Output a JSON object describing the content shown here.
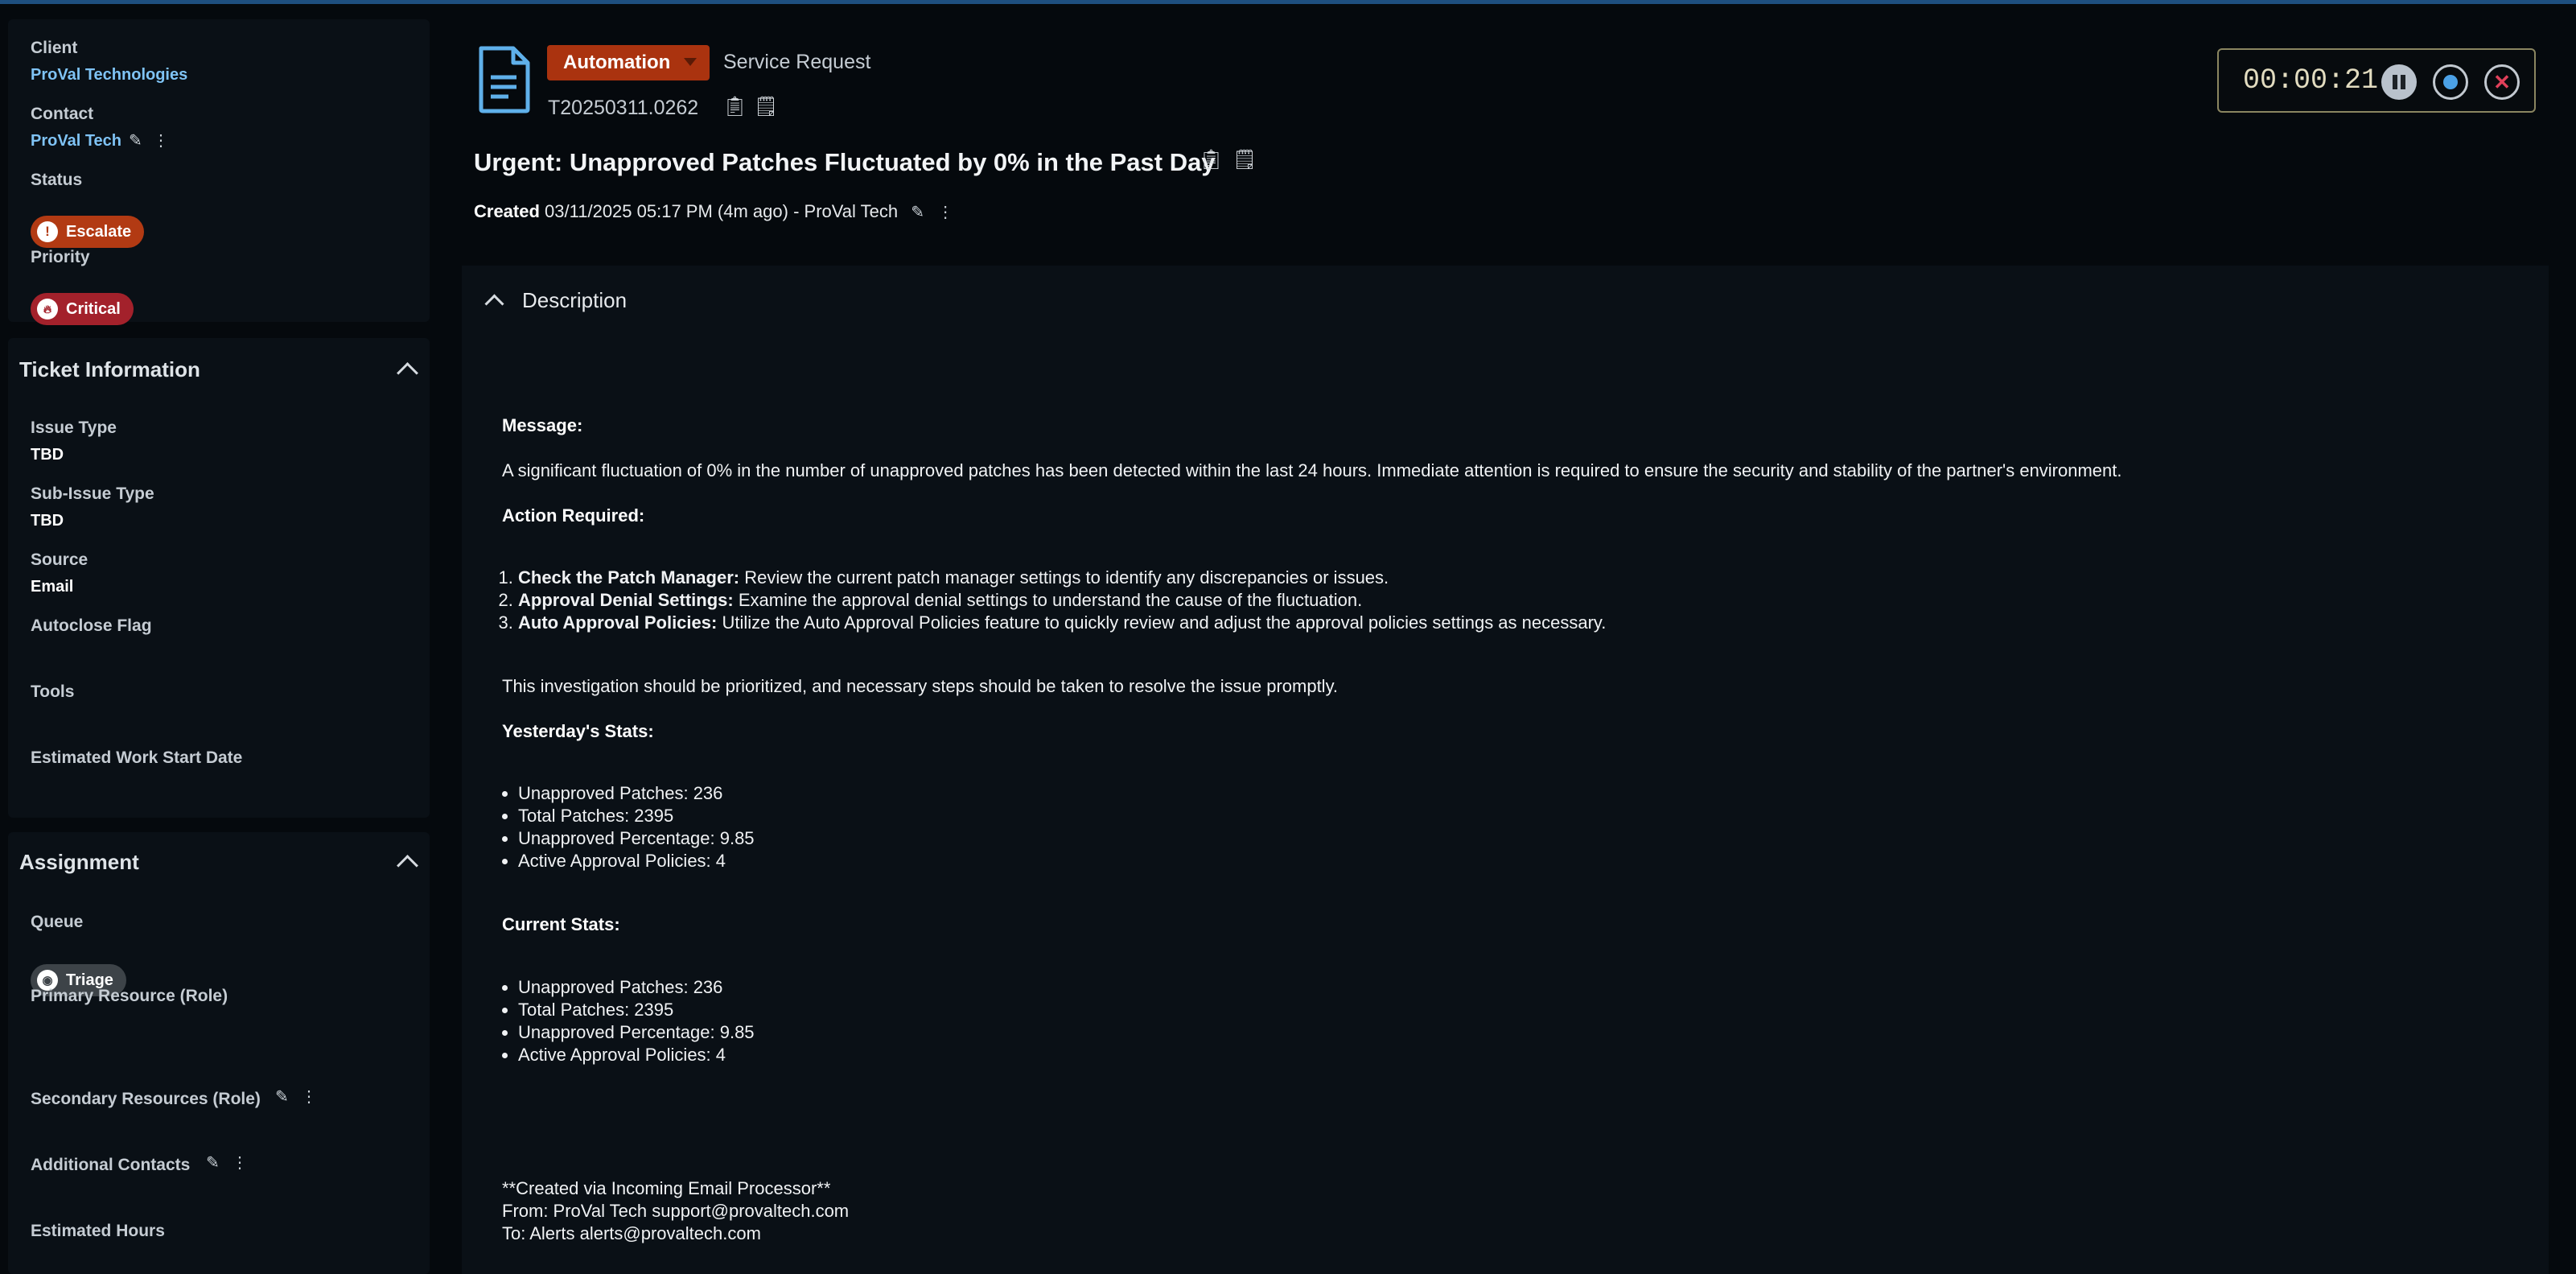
{
  "left": {
    "client_label": "Client",
    "client_value": "ProVal Technologies",
    "contact_label": "Contact",
    "contact_value": "ProVal Tech",
    "status_label": "Status",
    "status_value": "Escalate",
    "priority_label": "Priority",
    "priority_value": "Critical",
    "ticket_info": {
      "title": "Ticket Information",
      "issue_type_label": "Issue Type",
      "issue_type_value": "TBD",
      "sub_issue_label": "Sub-Issue Type",
      "sub_issue_value": "TBD",
      "source_label": "Source",
      "source_value": "Email",
      "autoclose_label": "Autoclose Flag",
      "tools_label": "Tools",
      "est_start_label": "Estimated Work Start Date"
    },
    "assignment": {
      "title": "Assignment",
      "queue_label": "Queue",
      "queue_value": "Triage",
      "primary_label": "Primary Resource (Role)",
      "secondary_label": "Secondary Resources (Role)",
      "additional_label": "Additional Contacts",
      "est_hours_label": "Estimated Hours"
    }
  },
  "header": {
    "type_button": "Automation",
    "service_request": "Service Request",
    "ticket_number": "T20250311.0262",
    "title": "Urgent: Unapproved Patches Fluctuated by 0% in the Past Day",
    "created_label": "Created",
    "created_value": "03/11/2025 05:17 PM (4m ago)",
    "created_sep": "-",
    "created_by": "ProVal Tech"
  },
  "timer": {
    "value": "00:00:21"
  },
  "description": {
    "title": "Description",
    "message_heading": "Message:",
    "message_text": "A significant fluctuation of 0% in the number of unapproved patches has been detected within the last 24 hours. Immediate attention is required to ensure the security and stability of the partner's environment.",
    "action_heading": "Action Required:",
    "actions": [
      {
        "bold": "Check the Patch Manager:",
        "text": " Review the current patch manager settings to identify any discrepancies or issues."
      },
      {
        "bold": "Approval Denial Settings:",
        "text": " Examine the approval denial settings to understand the cause of the fluctuation."
      },
      {
        "bold": "Auto Approval Policies:",
        "text": " Utilize the Auto Approval Policies feature to quickly review and adjust the approval policies settings as necessary."
      }
    ],
    "priority_note": "This investigation should be prioritized, and necessary steps should be taken to resolve the issue promptly.",
    "yesterday_heading": "Yesterday's Stats:",
    "yesterday_stats": [
      "Unapproved Patches: 236",
      "Total Patches: 2395",
      "Unapproved Percentage: 9.85",
      "Active Approval Policies: 4"
    ],
    "current_heading": "Current Stats:",
    "current_stats": [
      "Unapproved Patches: 236",
      "Total Patches: 2395",
      "Unapproved Percentage: 9.85",
      "Active Approval Policies: 4"
    ],
    "footer_created": "**Created via Incoming Email Processor**",
    "footer_from": "From: ProVal Tech support@provaltech.com",
    "footer_to": "To: Alerts alerts@provaltech.com"
  }
}
